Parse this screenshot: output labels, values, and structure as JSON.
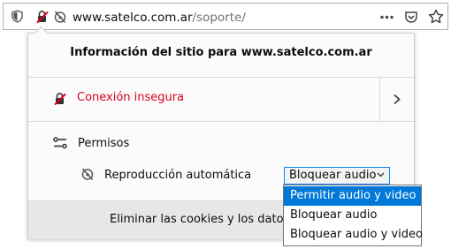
{
  "urlbar": {
    "host": "www.satelco.com.ar",
    "path": "/soporte/",
    "icons": [
      "shield-icon",
      "insecure-lock-icon",
      "autoplay-blocked-icon",
      "more-icon",
      "pocket-icon",
      "star-icon"
    ]
  },
  "panel": {
    "title": "Información del sitio para www.satelco.com.ar",
    "connection": {
      "label": "Conexión insegura",
      "color": "#d70022"
    },
    "permissions": {
      "label": "Permisos",
      "items": [
        {
          "label": "Reproducción automática",
          "selected": "Bloquear audio"
        }
      ]
    },
    "footer_text": "Eliminar las cookies y los datos d"
  },
  "dropdown": {
    "options": [
      "Permitir audio y video",
      "Bloquear audio",
      "Bloquear audio y video"
    ],
    "highlighted": "Permitir audio y video",
    "highlight_color": "#0078d7"
  }
}
